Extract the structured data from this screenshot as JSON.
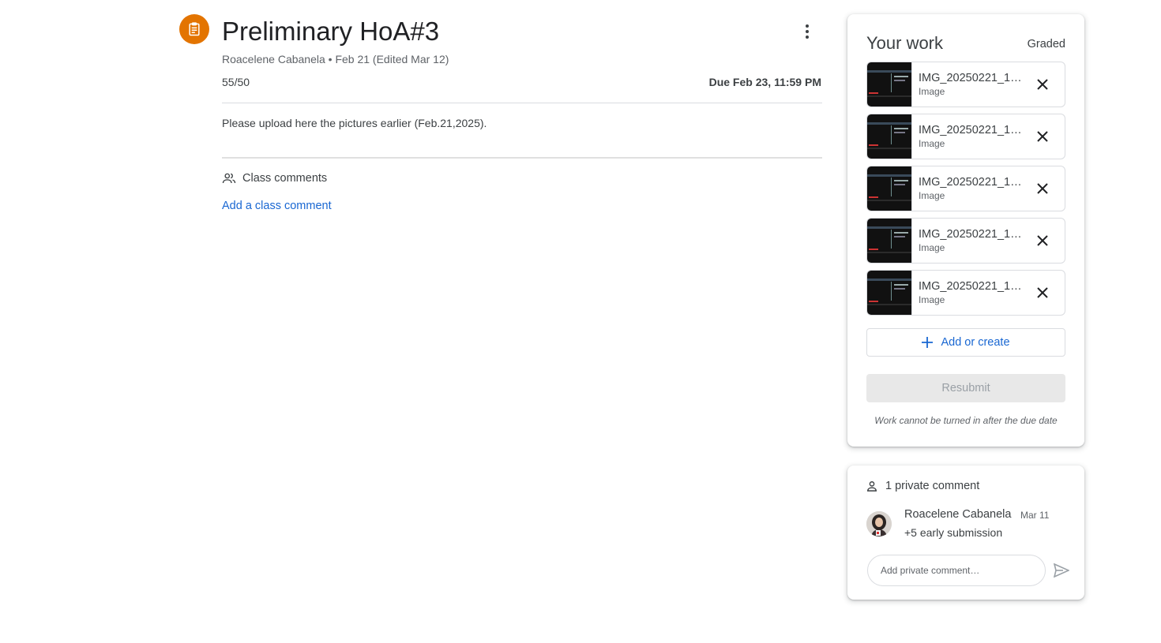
{
  "assignment": {
    "icon": "assignment-icon",
    "accent_color": "#e37400",
    "title": "Preliminary HoA#3",
    "meta": "Roacelene Cabanela • Feb 21 (Edited Mar 12)",
    "points": "55/50",
    "due": "Due Feb 23, 11:59 PM",
    "instructions": "Please upload here the pictures earlier (Feb.21,2025).",
    "more_icon": "more-vert-icon"
  },
  "class_comments": {
    "icon": "people-icon",
    "label": "Class comments",
    "add_label": "Add a class comment",
    "link_color": "#1967d2"
  },
  "your_work": {
    "title": "Your work",
    "status": "Graded",
    "attachments": [
      {
        "name": "IMG_20250221_16...",
        "type": "Image"
      },
      {
        "name": "IMG_20250221_16...",
        "type": "Image"
      },
      {
        "name": "IMG_20250221_16...",
        "type": "Image"
      },
      {
        "name": "IMG_20250221_16...",
        "type": "Image"
      },
      {
        "name": "IMG_20250221_16...",
        "type": "Image"
      }
    ],
    "remove_icon": "close-icon",
    "add_create_label": "Add or create",
    "add_icon": "plus-icon",
    "resubmit_label": "Resubmit",
    "notice": "Work cannot be turned in after the due date"
  },
  "private_comments": {
    "icon": "person-icon",
    "header": "1 private comment",
    "comments": [
      {
        "author": "Roacelene Cabanela",
        "date": "Mar 11",
        "body": "+5 early submission"
      }
    ],
    "input_placeholder": "Add private comment…",
    "send_icon": "send-icon"
  }
}
